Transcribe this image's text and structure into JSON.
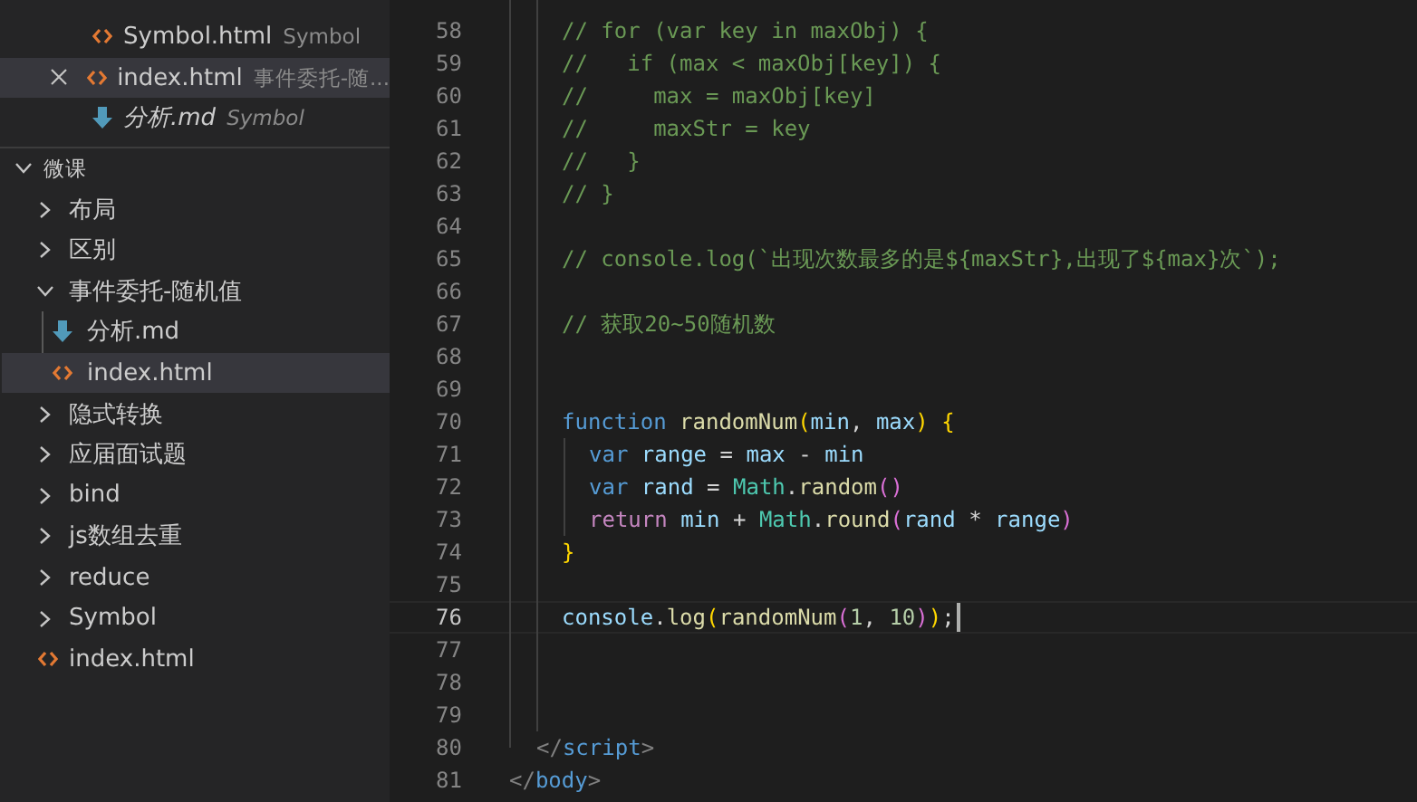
{
  "open_editors": [
    {
      "name": "Symbol.html",
      "description": "Symbol",
      "kind": "html",
      "preview": false,
      "selected": false
    },
    {
      "name": "index.html",
      "description": "事件委托-随...",
      "kind": "html",
      "preview": false,
      "selected": true
    },
    {
      "name": "分析.md",
      "description": "Symbol",
      "kind": "md",
      "preview": true,
      "selected": false
    }
  ],
  "explorer": {
    "title": "微课",
    "expanded": true,
    "items": [
      {
        "kind": "folder",
        "name": "布局",
        "expanded": false,
        "selected": false
      },
      {
        "kind": "folder",
        "name": "区别",
        "expanded": false,
        "selected": false
      },
      {
        "kind": "folder",
        "name": "事件委托-随机值",
        "expanded": true,
        "selected": false,
        "children": [
          {
            "kind": "md",
            "name": "分析.md",
            "selected": false
          },
          {
            "kind": "html",
            "name": "index.html",
            "selected": true
          }
        ]
      },
      {
        "kind": "folder",
        "name": "隐式转换",
        "expanded": false,
        "selected": false
      },
      {
        "kind": "folder",
        "name": "应届面试题",
        "expanded": false,
        "selected": false
      },
      {
        "kind": "folder",
        "name": "bind",
        "expanded": false,
        "selected": false
      },
      {
        "kind": "folder",
        "name": "js数组去重",
        "expanded": false,
        "selected": false
      },
      {
        "kind": "folder",
        "name": "reduce",
        "expanded": false,
        "selected": false
      },
      {
        "kind": "folder",
        "name": "Symbol",
        "expanded": false,
        "selected": false
      },
      {
        "kind": "html",
        "name": "index.html",
        "selected": false
      }
    ]
  },
  "editor": {
    "lines": [
      {
        "number": "58",
        "current": false,
        "kind": "script",
        "tokens": [
          {
            "kind": "comment",
            "text": "// for (var key in maxObj) {"
          }
        ]
      },
      {
        "number": "59",
        "current": false,
        "kind": "script",
        "tokens": [
          {
            "kind": "comment",
            "text": "//   if (max < maxObj[key]) {"
          }
        ]
      },
      {
        "number": "60",
        "current": false,
        "kind": "script",
        "tokens": [
          {
            "kind": "comment",
            "text": "//     max = maxObj[key]"
          }
        ]
      },
      {
        "number": "61",
        "current": false,
        "kind": "script",
        "tokens": [
          {
            "kind": "comment",
            "text": "//     maxStr = key"
          }
        ]
      },
      {
        "number": "62",
        "current": false,
        "kind": "script",
        "tokens": [
          {
            "kind": "comment",
            "text": "//   }"
          }
        ]
      },
      {
        "number": "63",
        "current": false,
        "kind": "script",
        "tokens": [
          {
            "kind": "comment",
            "text": "// }"
          }
        ]
      },
      {
        "number": "64",
        "current": false,
        "kind": "script"
      },
      {
        "number": "65",
        "current": false,
        "kind": "script",
        "tokens": [
          {
            "kind": "comment",
            "text": "// console.log(`出现次数最多的是${maxStr},出现了${max}次`);"
          }
        ]
      },
      {
        "number": "66",
        "current": false,
        "kind": "script"
      },
      {
        "number": "67",
        "current": false,
        "kind": "script",
        "tokens": [
          {
            "kind": "comment",
            "text": "// 获取20~50随机数"
          }
        ]
      },
      {
        "number": "68",
        "current": false,
        "kind": "script"
      },
      {
        "number": "69",
        "current": false,
        "kind": "script"
      },
      {
        "number": "70",
        "current": false,
        "kind": "script",
        "tokens": [
          {
            "kind": "keyword",
            "text": "function "
          },
          {
            "kind": "function",
            "text": "randomNum"
          },
          {
            "kind": "bracket1",
            "text": "("
          },
          {
            "kind": "variable",
            "text": "min"
          },
          {
            "kind": "plain",
            "text": ", "
          },
          {
            "kind": "variable",
            "text": "max"
          },
          {
            "kind": "bracket1",
            "text": ") {"
          }
        ]
      },
      {
        "number": "71",
        "current": false,
        "kind": "function",
        "tokens": [
          {
            "kind": "keyword",
            "text": "var "
          },
          {
            "kind": "variable",
            "text": "range"
          },
          {
            "kind": "plain",
            "text": " = "
          },
          {
            "kind": "variable",
            "text": "max"
          },
          {
            "kind": "plain",
            "text": " - "
          },
          {
            "kind": "variable",
            "text": "min"
          }
        ]
      },
      {
        "number": "72",
        "current": false,
        "kind": "function",
        "tokens": [
          {
            "kind": "keyword",
            "text": "var "
          },
          {
            "kind": "variable",
            "text": "rand"
          },
          {
            "kind": "plain",
            "text": " = "
          },
          {
            "kind": "class",
            "text": "Math"
          },
          {
            "kind": "plain",
            "text": "."
          },
          {
            "kind": "function",
            "text": "random"
          },
          {
            "kind": "bracket2",
            "text": "()"
          }
        ]
      },
      {
        "number": "73",
        "current": false,
        "kind": "function",
        "tokens": [
          {
            "kind": "control",
            "text": "return "
          },
          {
            "kind": "variable",
            "text": "min"
          },
          {
            "kind": "plain",
            "text": " + "
          },
          {
            "kind": "class",
            "text": "Math"
          },
          {
            "kind": "plain",
            "text": "."
          },
          {
            "kind": "function",
            "text": "round"
          },
          {
            "kind": "bracket2",
            "text": "("
          },
          {
            "kind": "variable",
            "text": "rand"
          },
          {
            "kind": "plain",
            "text": " * "
          },
          {
            "kind": "variable",
            "text": "range"
          },
          {
            "kind": "bracket2",
            "text": ")"
          }
        ]
      },
      {
        "number": "74",
        "current": false,
        "kind": "script",
        "tokens": [
          {
            "kind": "bracket1",
            "text": "}"
          }
        ]
      },
      {
        "number": "75",
        "current": false,
        "kind": "script"
      },
      {
        "number": "76",
        "current": true,
        "kind": "script",
        "tokens": [
          {
            "kind": "variable",
            "text": "console"
          },
          {
            "kind": "plain",
            "text": "."
          },
          {
            "kind": "function",
            "text": "log"
          },
          {
            "kind": "bracket1",
            "text": "("
          },
          {
            "kind": "function",
            "text": "randomNum"
          },
          {
            "kind": "bracket2",
            "text": "("
          },
          {
            "kind": "number",
            "text": "1"
          },
          {
            "kind": "plain",
            "text": ", "
          },
          {
            "kind": "number",
            "text": "10"
          },
          {
            "kind": "bracket2",
            "text": ")"
          },
          {
            "kind": "bracket1",
            "text": ")"
          },
          {
            "kind": "plain",
            "text": ";"
          }
        ]
      },
      {
        "number": "77",
        "current": false,
        "kind": "script"
      },
      {
        "number": "78",
        "current": false,
        "kind": "script"
      },
      {
        "number": "79",
        "current": false,
        "kind": "script"
      },
      {
        "number": "80",
        "current": false,
        "kind": "body",
        "tokens": [
          {
            "kind": "tagpunct",
            "text": "</"
          },
          {
            "kind": "tag",
            "text": "script"
          },
          {
            "kind": "tagpunct",
            "text": ">"
          }
        ]
      },
      {
        "number": "81",
        "current": false,
        "kind": "html",
        "tokens": [
          {
            "kind": "tagpunct",
            "text": "</"
          },
          {
            "kind": "tag",
            "text": "body"
          },
          {
            "kind": "tagpunct",
            "text": ">"
          }
        ]
      }
    ]
  }
}
